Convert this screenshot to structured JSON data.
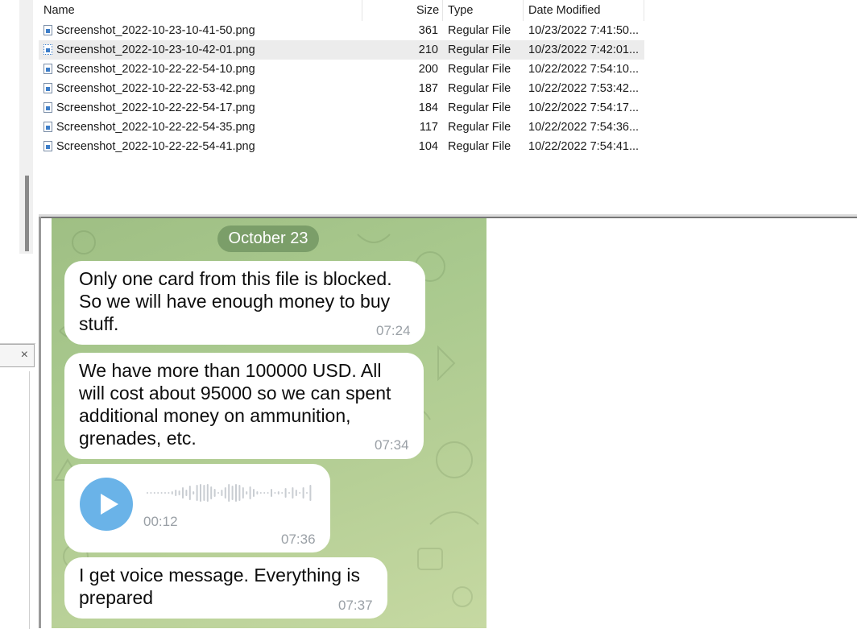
{
  "file_list": {
    "columns": [
      "Name",
      "Size",
      "Type",
      "Date Modified"
    ],
    "rows": [
      {
        "name": "Screenshot_2022-10-23-10-41-50.png",
        "size": "361",
        "type": "Regular File",
        "date": "10/23/2022 7:41:50..."
      },
      {
        "name": "Screenshot_2022-10-23-10-42-01.png",
        "size": "210",
        "type": "Regular File",
        "date": "10/23/2022 7:42:01...",
        "selected": true
      },
      {
        "name": "Screenshot_2022-10-22-22-54-10.png",
        "size": "200",
        "type": "Regular File",
        "date": "10/22/2022 7:54:10..."
      },
      {
        "name": "Screenshot_2022-10-22-22-53-42.png",
        "size": "187",
        "type": "Regular File",
        "date": "10/22/2022 7:53:42..."
      },
      {
        "name": "Screenshot_2022-10-22-22-54-17.png",
        "size": "184",
        "type": "Regular File",
        "date": "10/22/2022 7:54:17..."
      },
      {
        "name": "Screenshot_2022-10-22-22-54-35.png",
        "size": "117",
        "type": "Regular File",
        "date": "10/22/2022 7:54:36..."
      },
      {
        "name": "Screenshot_2022-10-22-22-54-41.png",
        "size": "104",
        "type": "Regular File",
        "date": "10/22/2022 7:54:41..."
      }
    ]
  },
  "left_panel": {
    "close_glyph": "×"
  },
  "chat": {
    "date_label": "October 23",
    "messages": [
      {
        "lines": [
          "Only one card from this file is blocked.",
          "So we will have enough money to buy",
          "stuff."
        ],
        "time": "07:24"
      },
      {
        "lines": [
          "We have more than 100000 USD. All",
          "will cost about 95000 so we can spent",
          "additional money on ammunition,",
          "grenades, etc."
        ],
        "time": "07:34"
      },
      {
        "voice_duration": "00:12",
        "time": "07:36"
      },
      {
        "lines": [
          "I get voice message. Everything is",
          "prepared"
        ],
        "time": "07:37"
      }
    ]
  },
  "colors": {
    "selection": "#ececec",
    "play_button": "#6ab3e8",
    "date_pill": "#7094 60",
    "timestamp": "#9aa0a6"
  }
}
